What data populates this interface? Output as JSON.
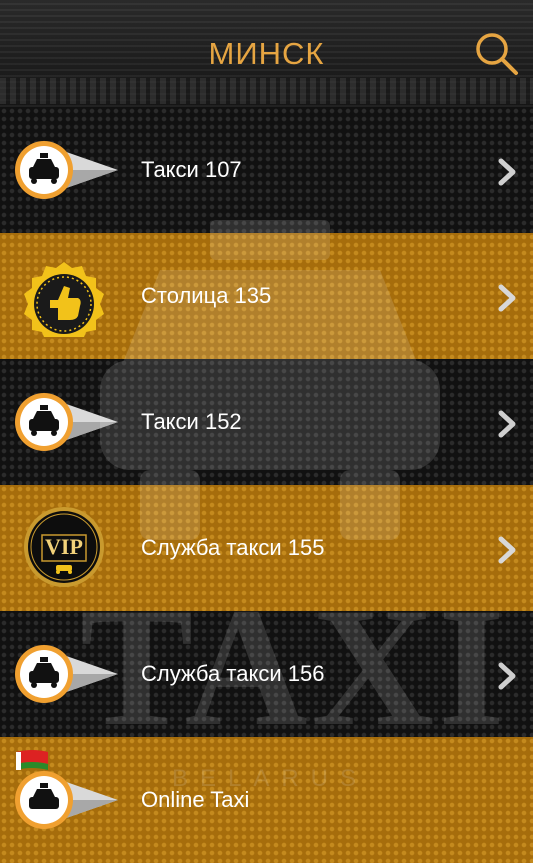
{
  "header": {
    "title": "МИНСК"
  },
  "icons": {
    "search": "search-icon",
    "chevron": "chevron-right-icon"
  },
  "colors": {
    "accent": "#e6a542",
    "gold_row": "#a66d0c",
    "dark_row": "#111111"
  },
  "watermark": {
    "text": "TAXI",
    "sub": "BELARUS"
  },
  "list": {
    "items": [
      {
        "label": "Такси 107",
        "icon": "taxi-pin-icon",
        "style": "dark"
      },
      {
        "label": "Столица 135",
        "icon": "thumbs-up-badge-icon",
        "style": "gold"
      },
      {
        "label": "Такси 152",
        "icon": "taxi-pin-icon",
        "style": "dark"
      },
      {
        "label": "Служба такси 155",
        "icon": "vip-badge-icon",
        "style": "gold"
      },
      {
        "label": "Служба такси 156",
        "icon": "taxi-pin-icon",
        "style": "dark"
      },
      {
        "label": "Online Taxi",
        "icon": "taxi-pin-icon",
        "style": "gold"
      }
    ]
  }
}
